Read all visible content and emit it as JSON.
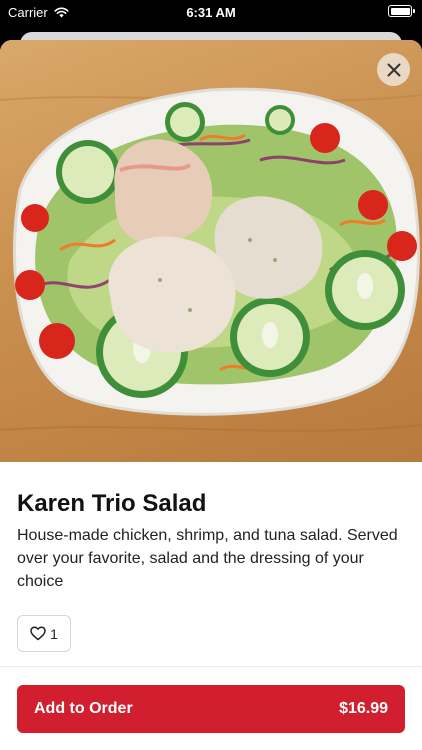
{
  "status_bar": {
    "carrier": "Carrier",
    "time": "6:31 AM",
    "wifi_icon": "wifi-icon",
    "battery_icon": "battery-icon"
  },
  "item": {
    "image_alt_icon": "salad-photo",
    "title": "Karen Trio Salad",
    "description": "House-made chicken, shrimp, and tuna salad. Served over your favorite, salad and the dressing of your choice",
    "likes": "1",
    "like_icon": "heart-icon"
  },
  "close_icon": "close-icon",
  "order": {
    "label": "Add to Order",
    "price": "$16.99"
  },
  "colors": {
    "accent": "#d11f2f",
    "wood": "#c98f4e"
  }
}
